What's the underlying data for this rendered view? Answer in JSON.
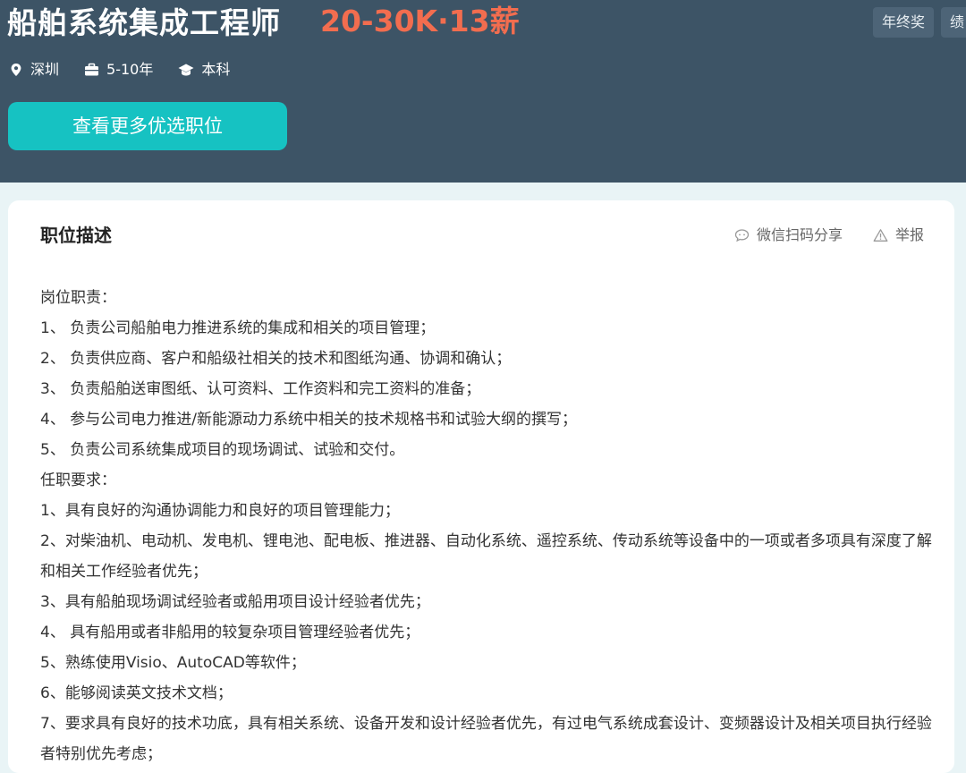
{
  "job": {
    "title": "船舶系统集成工程师",
    "salary": "20-30K·13薪",
    "tags": [
      "年终奖",
      "绩"
    ],
    "location": "深圳",
    "experience": "5-10年",
    "education": "本科",
    "cta_label": "查看更多优选职位"
  },
  "icons": {
    "location": "map-pin-icon",
    "experience": "briefcase-icon",
    "education": "graduation-cap-icon",
    "wechat": "chat-bubble-icon",
    "report": "warning-icon"
  },
  "colors": {
    "header_bg": "#3d5466",
    "salary": "#f26d4f",
    "cta_bg": "#16c2c2"
  },
  "description": {
    "section_title": "职位描述",
    "wechat_share": "微信扫码分享",
    "report": "举报",
    "lines": [
      "岗位职责：",
      "1、 负责公司船舶电力推进系统的集成和相关的项目管理；",
      "2、 负责供应商、客户和船级社相关的技术和图纸沟通、协调和确认；",
      "3、 负责船舶送审图纸、认可资料、工作资料和完工资料的准备；",
      "4、 参与公司电力推进/新能源动力系统中相关的技术规格书和试验大纲的撰写；",
      "5、 负责公司系统集成项目的现场调试、试验和交付。",
      "任职要求：",
      "1、具有良好的沟通协调能力和良好的项目管理能力；",
      "2、对柴油机、电动机、发电机、锂电池、配电板、推进器、自动化系统、遥控系统、传动系统等设备中的一项或者多项具有深度了解和相关工作经验者优先；",
      "3、具有船舶现场调试经验者或船用项目设计经验者优先；",
      "4、 具有船用或者非船用的较复杂项目管理经验者优先；",
      "5、熟练使用Visio、AutoCAD等软件；",
      "6、能够阅读英文技术文档；",
      "7、要求具有良好的技术功底，具有相关系统、设备开发和设计经验者优先，有过电气系统成套设计、变频器设计及相关项目执行经验者特别优先考虑；"
    ]
  }
}
